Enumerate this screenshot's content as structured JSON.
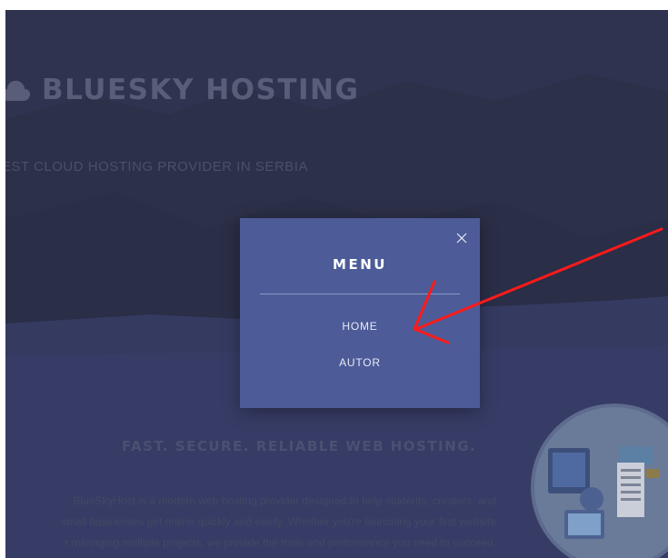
{
  "brand": {
    "title": "BLUESKY HOSTING",
    "logo_icon": "cloud-icon"
  },
  "hero": {
    "tagline": "EST CLOUD HOSTING PROVIDER IN SERBIA"
  },
  "section": {
    "title": "FAST. SECURE. RELIABLE WEB HOSTING.",
    "description_lines": [
      "BlueSkyHost is a modern web hosting provider designed to help students, creators, and",
      "small businesses get online quickly and easily. Whether you're launching your first website",
      "r managing multiple projects, we provide the tools and performance you need to succeed."
    ]
  },
  "modal": {
    "title": "MENU",
    "close_icon": "close-icon",
    "items": [
      {
        "label": "HOME"
      },
      {
        "label": "AUTOR"
      }
    ]
  },
  "colors": {
    "modal_bg": "#4d5c98",
    "page_bg": "#2f3350",
    "annotation": "#ff1a1a"
  }
}
